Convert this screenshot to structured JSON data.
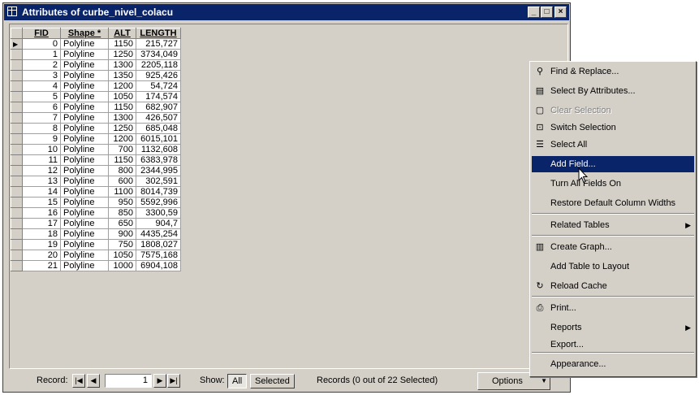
{
  "window": {
    "title": "Attributes of curbe_nivel_colacu"
  },
  "table": {
    "columns": [
      "FID",
      "Shape *",
      "ALT",
      "LENGTH"
    ],
    "rows": [
      [
        "0",
        "Polyline",
        "1150",
        "215,727"
      ],
      [
        "1",
        "Polyline",
        "1250",
        "3734,049"
      ],
      [
        "2",
        "Polyline",
        "1300",
        "2205,118"
      ],
      [
        "3",
        "Polyline",
        "1350",
        "925,426"
      ],
      [
        "4",
        "Polyline",
        "1200",
        "54,724"
      ],
      [
        "5",
        "Polyline",
        "1050",
        "174,574"
      ],
      [
        "6",
        "Polyline",
        "1150",
        "682,907"
      ],
      [
        "7",
        "Polyline",
        "1300",
        "426,507"
      ],
      [
        "8",
        "Polyline",
        "1250",
        "685,048"
      ],
      [
        "9",
        "Polyline",
        "1200",
        "6015,101"
      ],
      [
        "10",
        "Polyline",
        "700",
        "1132,608"
      ],
      [
        "11",
        "Polyline",
        "1150",
        "6383,978"
      ],
      [
        "12",
        "Polyline",
        "800",
        "2344,995"
      ],
      [
        "13",
        "Polyline",
        "600",
        "302,591"
      ],
      [
        "14",
        "Polyline",
        "1100",
        "8014,739"
      ],
      [
        "15",
        "Polyline",
        "950",
        "5592,996"
      ],
      [
        "16",
        "Polyline",
        "850",
        "3300,59"
      ],
      [
        "17",
        "Polyline",
        "650",
        "904,7"
      ],
      [
        "18",
        "Polyline",
        "900",
        "4435,254"
      ],
      [
        "19",
        "Polyline",
        "750",
        "1808,027"
      ],
      [
        "20",
        "Polyline",
        "1050",
        "7575,168"
      ],
      [
        "21",
        "Polyline",
        "1000",
        "6904,108"
      ]
    ]
  },
  "status": {
    "record_label": "Record:",
    "record_value": "1",
    "show_label": "Show:",
    "all_label": "All",
    "selected_label": "Selected",
    "records_text": "Records (0 out of 22 Selected)",
    "options_label": "Options"
  },
  "menu": {
    "items": [
      {
        "label": "Find & Replace...",
        "icon": "binoculars-icon"
      },
      {
        "label": "Select By Attributes...",
        "icon": "sql-icon"
      },
      {
        "label": "Clear Selection",
        "icon": "clear-selection-icon",
        "disabled": true
      },
      {
        "label": "Switch Selection",
        "icon": "switch-selection-icon"
      },
      {
        "label": "Select All",
        "icon": "select-all-icon"
      },
      {
        "label": "Add Field...",
        "highlight": true
      },
      {
        "label": "Turn All Fields On"
      },
      {
        "label": "Restore Default Column Widths"
      },
      {
        "label": "Related Tables",
        "submenu": true
      },
      {
        "label": "Create Graph...",
        "icon": "graph-icon"
      },
      {
        "label": "Add Table to Layout"
      },
      {
        "label": "Reload Cache",
        "icon": "reload-icon"
      },
      {
        "label": "Print...",
        "icon": "printer-icon"
      },
      {
        "label": "Reports",
        "submenu": true
      },
      {
        "label": "Export..."
      },
      {
        "label": "Appearance..."
      }
    ]
  },
  "colors": {
    "title_bar": "#0a246a",
    "face": "#d4d0c8",
    "highlight": "#0a246a"
  }
}
